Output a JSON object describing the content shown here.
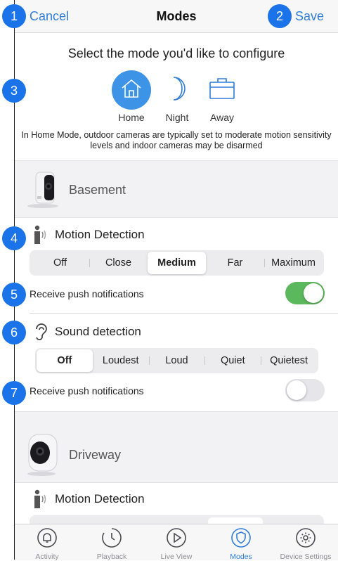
{
  "header": {
    "cancel_label": "Cancel",
    "title": "Modes",
    "save_label": "Save"
  },
  "callouts": [
    "1",
    "2",
    "3",
    "4",
    "5",
    "6",
    "7"
  ],
  "select_title": "Select the mode you'd like to configure",
  "modes": [
    {
      "label": "Home",
      "icon": "home-icon",
      "selected": true
    },
    {
      "label": "Night",
      "icon": "moon-icon",
      "selected": false
    },
    {
      "label": "Away",
      "icon": "briefcase-icon",
      "selected": false
    }
  ],
  "description": "In Home Mode, outdoor cameras are typically set to moderate motion sensitivity levels and indoor cameras may be disarmed",
  "cameras": [
    {
      "name": "Basement",
      "motion": {
        "title": "Motion Detection",
        "options": [
          "Off",
          "Close",
          "Medium",
          "Far",
          "Maximum"
        ],
        "selected": "Medium",
        "push_label": "Receive push notifications",
        "push_enabled": true
      },
      "sound": {
        "title": "Sound detection",
        "options": [
          "Off",
          "Loudest",
          "Loud",
          "Quiet",
          "Quietest"
        ],
        "selected": "Off",
        "push_label": "Receive push notifications",
        "push_enabled": false
      }
    },
    {
      "name": "Driveway",
      "motion": {
        "title": "Motion Detection"
      }
    }
  ],
  "tabbar": [
    {
      "label": "Activity",
      "icon": "bell-icon",
      "active": false
    },
    {
      "label": "Playback",
      "icon": "clock-icon",
      "active": false
    },
    {
      "label": "Live View",
      "icon": "play-icon",
      "active": false
    },
    {
      "label": "Modes",
      "icon": "shield-icon",
      "active": true
    },
    {
      "label": "Device Settings",
      "icon": "gear-icon",
      "active": false
    }
  ],
  "colors": {
    "accent": "#2f7dd7",
    "callout": "#1a73e8",
    "toggle_on": "#5cb85c"
  }
}
